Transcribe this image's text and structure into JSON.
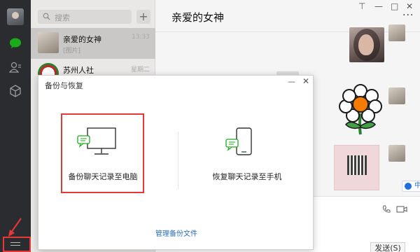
{
  "search": {
    "placeholder": "搜索"
  },
  "chats": [
    {
      "name": "亲爱的女神",
      "time": "13:33",
      "preview": "[图片]"
    },
    {
      "name": "苏州人社",
      "time": "星期二",
      "preview": ""
    }
  ],
  "chat": {
    "title": "亲爱的女神",
    "send_label": "发送(S)",
    "badge_label": "中"
  },
  "dialog": {
    "title": "备份与恢复",
    "option_pc": "备份聊天记录至电脑",
    "option_phone": "恢复聊天记录至手机",
    "manage_link": "管理备份文件"
  },
  "colors": {
    "accent_green": "#1aad19",
    "highlight_red": "#e53935",
    "link_blue": "#2a6fb8"
  }
}
